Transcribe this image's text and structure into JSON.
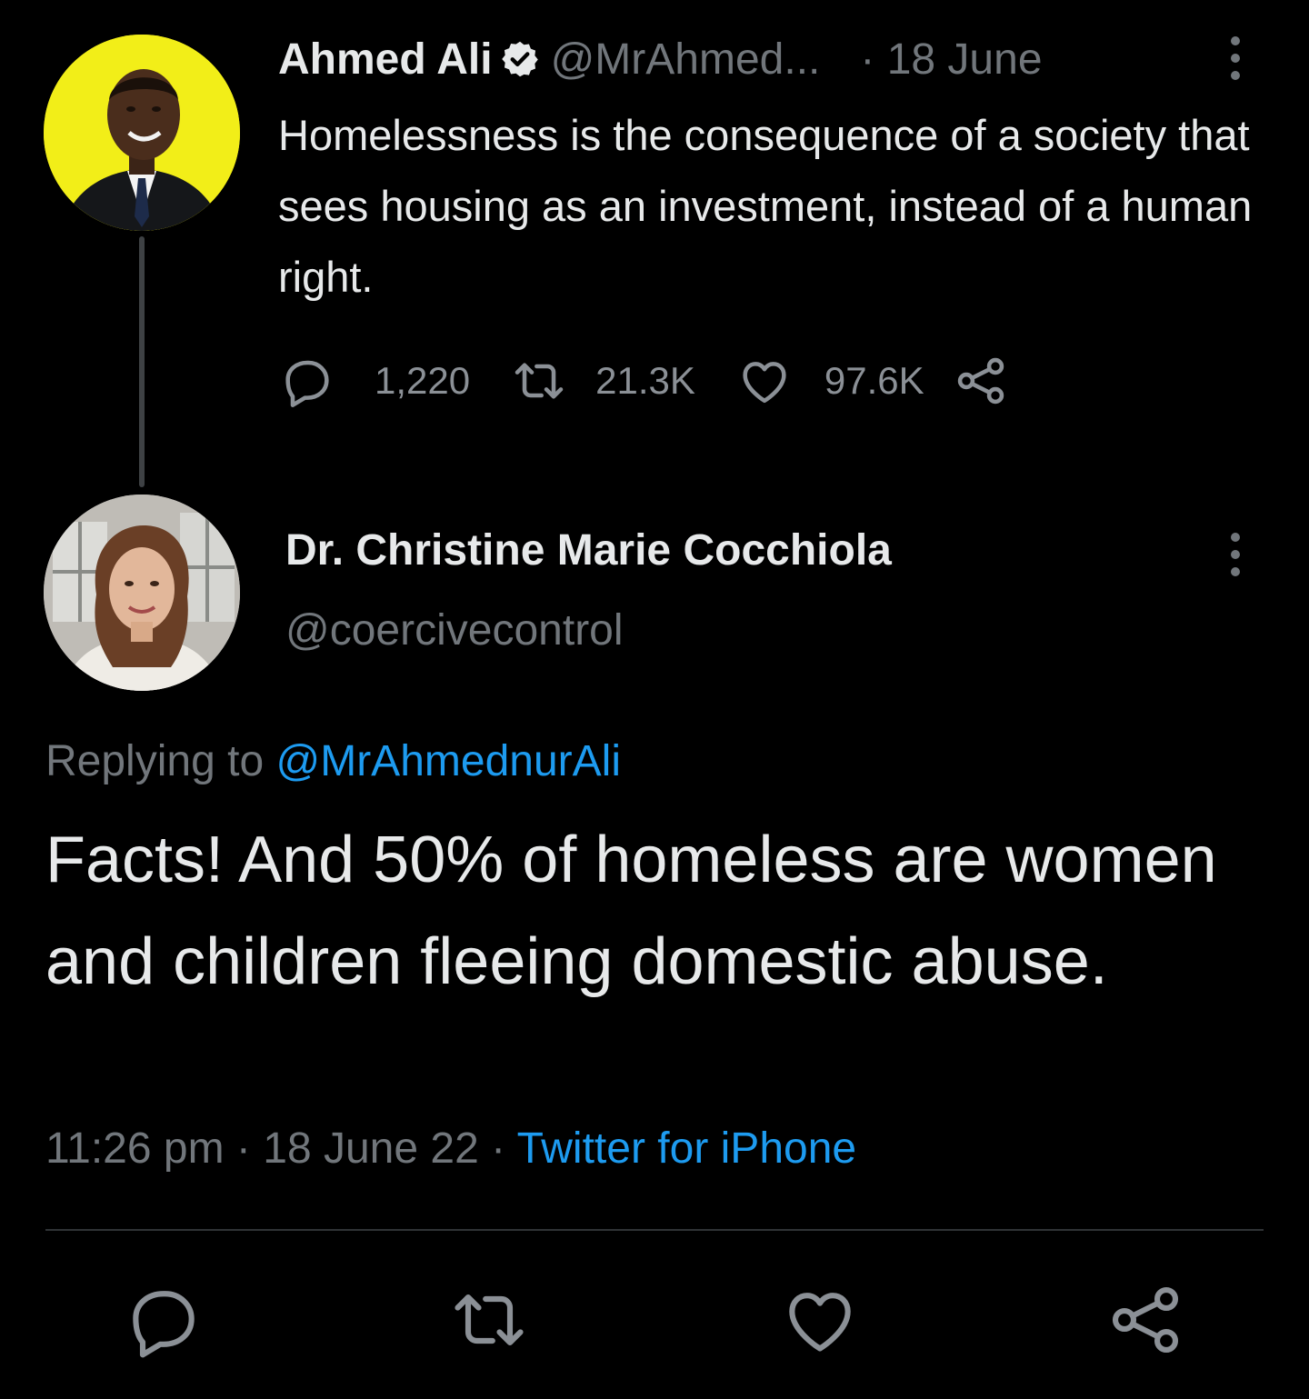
{
  "parent_tweet": {
    "author_name": "Ahmed Ali",
    "handle": "@MrAhmed...",
    "date": "· 18 June",
    "text": "Homelessness is the consequence of a society that sees housing as an investment, instead of a human right.",
    "reply_count": "1,220",
    "retweet_count": "21.3K",
    "like_count": "97.6K",
    "avatar_bg": "#f2ee18"
  },
  "reply_tweet": {
    "author_name": "Dr. Christine Marie Cocchiola",
    "handle": "@coercivecontrol",
    "replying_to_label": "Replying to",
    "replying_to_handle": "@MrAhmednurAli",
    "text": "Facts! And 50% of homeless are women and children fleeing domestic abuse.",
    "time": "11:26 pm",
    "date": "18 June 22",
    "separator": "·",
    "source": "Twitter for iPhone"
  },
  "colors": {
    "background": "#000000",
    "text_primary": "#e7e9ea",
    "text_secondary": "#71767b",
    "accent": "#1d9bf0",
    "divider": "#2f3336"
  },
  "icons": {
    "reply": "reply-icon",
    "retweet": "retweet-icon",
    "like": "heart-icon",
    "share": "share-icon",
    "more": "more-vertical-icon",
    "verified": "verified-badge-icon"
  }
}
